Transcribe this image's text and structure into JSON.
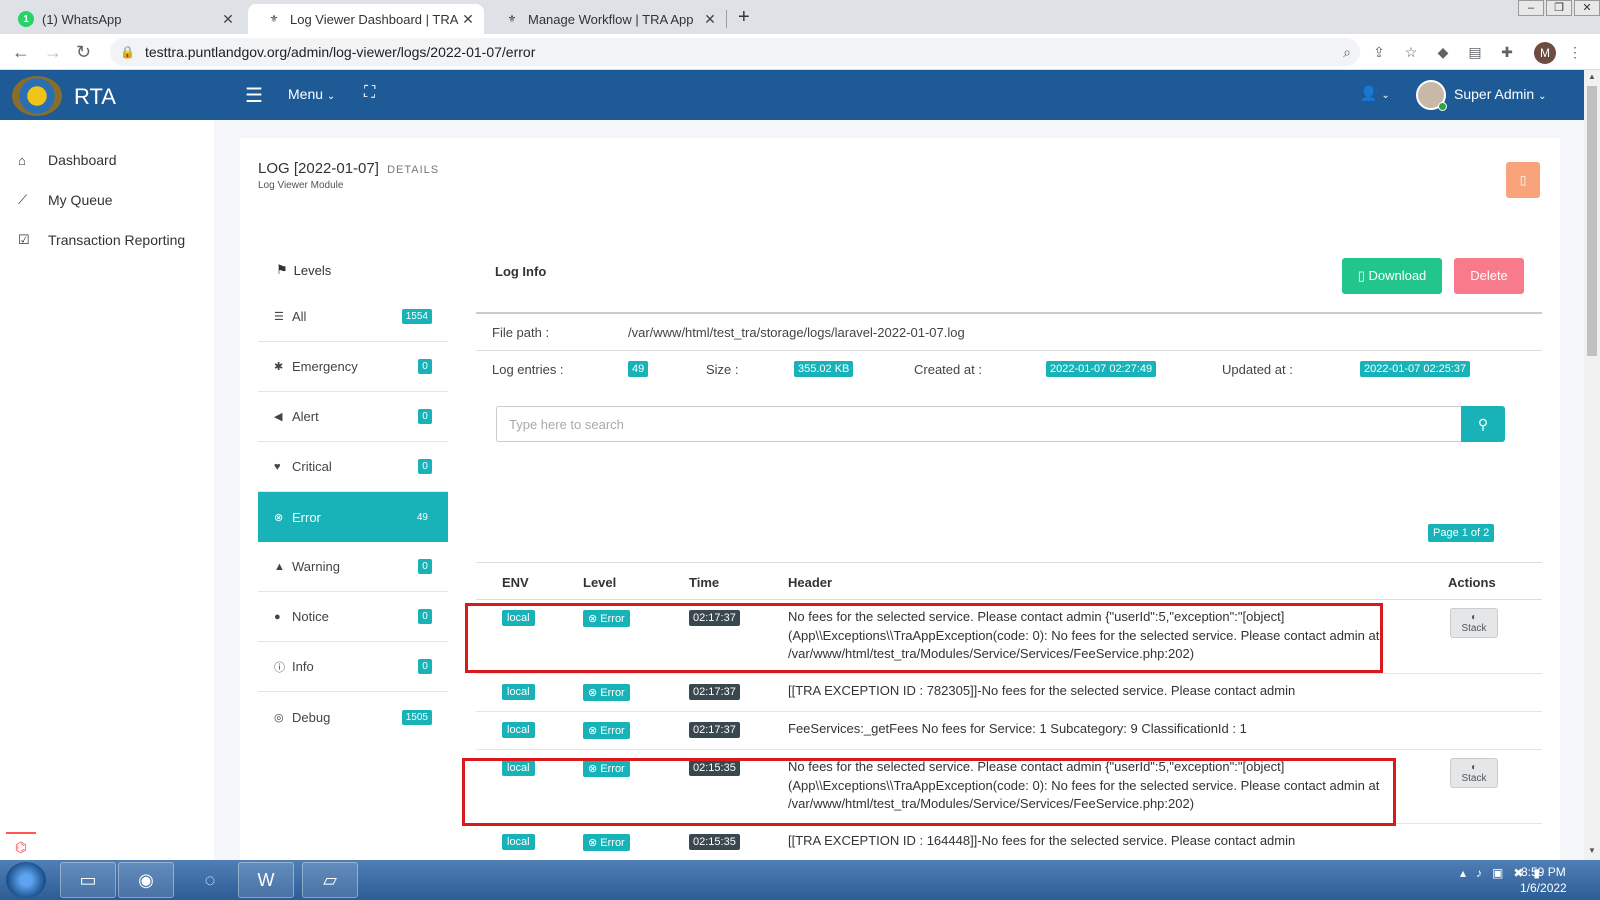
{
  "browser": {
    "tabs": [
      {
        "title": "(1) WhatsApp",
        "favicon": "whatsapp-icon",
        "active": false
      },
      {
        "title": "Log Viewer Dashboard | TRA App",
        "favicon": "emblem-icon",
        "active": true
      },
      {
        "title": "Manage Workflow | TRA App",
        "favicon": "emblem-icon",
        "active": false
      }
    ],
    "tab_close": "✕",
    "new_tab": "+",
    "url": "testtra.puntlandgov.org/admin/log-viewer/logs/2022-01-07/error",
    "profile_initial": "M"
  },
  "app": {
    "brand": "RTA",
    "menu_label": "Menu",
    "user_name": "Super Admin"
  },
  "sidebar": {
    "items": [
      {
        "label": "Dashboard",
        "icon": "home-icon"
      },
      {
        "label": "My Queue",
        "icon": "chart-line-icon"
      },
      {
        "label": "Transaction Reporting",
        "icon": "check-square-icon"
      }
    ]
  },
  "page": {
    "title": "LOG [2022-01-07]",
    "title_suffix": "DETAILS",
    "subtitle": "Log Viewer Module"
  },
  "levels": {
    "heading": "Levels",
    "items": [
      {
        "label": "All",
        "count": "1554",
        "icon": "list-icon"
      },
      {
        "label": "Emergency",
        "count": "0",
        "icon": "bug-icon"
      },
      {
        "label": "Alert",
        "count": "0",
        "icon": "bullhorn-icon"
      },
      {
        "label": "Critical",
        "count": "0",
        "icon": "heartbeat-icon"
      },
      {
        "label": "Error",
        "count": "49",
        "icon": "times-circle-icon"
      },
      {
        "label": "Warning",
        "count": "0",
        "icon": "warning-icon"
      },
      {
        "label": "Notice",
        "count": "0",
        "icon": "exclamation-circle-icon"
      },
      {
        "label": "Info",
        "count": "0",
        "icon": "info-circle-icon"
      },
      {
        "label": "Debug",
        "count": "1505",
        "icon": "life-ring-icon"
      }
    ],
    "active": "Error"
  },
  "log_info": {
    "title": "Log Info",
    "download_label": "Download",
    "delete_label": "Delete",
    "file_path_label": "File path :",
    "file_path": "/var/www/html/test_tra/storage/logs/laravel-2022-01-07.log",
    "entries_label": "Log entries :",
    "entries": "49",
    "size_label": "Size :",
    "size": "355.02 KB",
    "created_label": "Created at :",
    "created": "2022-01-07 02:27:49",
    "updated_label": "Updated at :",
    "updated": "2022-01-07 02:25:37"
  },
  "search": {
    "placeholder": "Type here to search"
  },
  "pagination": {
    "label": "Page 1 of 2"
  },
  "table": {
    "headers": {
      "env": "ENV",
      "level": "Level",
      "time": "Time",
      "header": "Header",
      "actions": "Actions"
    },
    "stack_label": "Stack",
    "rows": [
      {
        "env": "local",
        "level": "Error",
        "time": "02:17:37",
        "header": "No fees for the selected service. Please contact admin {\"userId\":5,\"exception\":\"[object] (App\\\\Exceptions\\\\TraAppException(code: 0): No fees for the selected service. Please contact admin at /var/www/html/test_tra/Modules/Service/Services/FeeService.php:202)",
        "stack": true,
        "highlighted": true
      },
      {
        "env": "local",
        "level": "Error",
        "time": "02:17:37",
        "header": "[[TRA EXCEPTION ID : 782305]]-No fees for the selected service. Please contact admin",
        "stack": false,
        "highlighted": false
      },
      {
        "env": "local",
        "level": "Error",
        "time": "02:17:37",
        "header": "FeeServices:_getFees No fees for Service: 1 Subcategory: 9 ClassificationId : 1",
        "stack": false,
        "highlighted": false
      },
      {
        "env": "local",
        "level": "Error",
        "time": "02:15:35",
        "header": "No fees for the selected service. Please contact admin {\"userId\":5,\"exception\":\"[object] (App\\\\Exceptions\\\\TraAppException(code: 0): No fees for the selected service. Please contact admin at /var/www/html/test_tra/Modules/Service/Services/FeeService.php:202)",
        "stack": true,
        "highlighted": true
      },
      {
        "env": "local",
        "level": "Error",
        "time": "02:15:35",
        "header": "[[TRA EXCEPTION ID : 164448]]-No fees for the selected service. Please contact admin",
        "stack": false,
        "highlighted": false
      }
    ]
  },
  "taskbar": {
    "time": "8:59 PM",
    "date": "1/6/2022"
  },
  "colors": {
    "header_blue": "#1e5a96",
    "teal": "#17b3b8",
    "download_green": "#22c58b",
    "delete_pink": "#f77b8a",
    "highlight_red": "#d9191c"
  }
}
